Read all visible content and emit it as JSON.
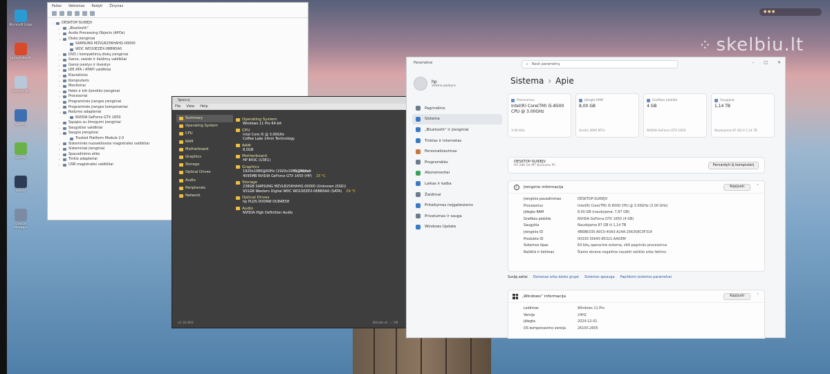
{
  "watermark": "skelbiu.lt",
  "desktop_icons": [
    {
      "label": "Microsoft Edge",
      "icon": "edge-icon",
      "color": "#2b9bd6"
    },
    {
      "label": "Uplay/Ubisoft",
      "icon": "game-launcher-icon",
      "color": "#d84a2a"
    },
    {
      "label": "Recycle Bin",
      "icon": "recycle-bin-icon",
      "color": "#b8c7d9"
    },
    {
      "label": "Speccy",
      "icon": "speccy-icon",
      "color": "#3e6fb0"
    },
    {
      "label": "Spotify",
      "icon": "app-icon",
      "color": "#6bb14a"
    },
    {
      "label": "Steam",
      "icon": "steam-icon",
      "color": "#2e3b57"
    },
    {
      "label": "Device Manager",
      "icon": "device-manager-icon",
      "color": "#7a8ba3"
    }
  ],
  "device_manager": {
    "menu": [
      "Failas",
      "Veiksmas",
      "Rodyti",
      "Žinynas"
    ],
    "tree": [
      {
        "text": "DESKTOP-SUI6EJV",
        "toggle": "⌄",
        "indent": 0
      },
      {
        "text": "„Bluetooth“",
        "toggle": "›",
        "indent": 1
      },
      {
        "text": "Audio Processing Objects (APOs)",
        "toggle": "›",
        "indent": 1
      },
      {
        "text": "Disko įrenginiai",
        "toggle": "⌄",
        "indent": 1
      },
      {
        "text": "SAMSUNG MZVLB256HAHQ-00000",
        "toggle": "",
        "indent": 2
      },
      {
        "text": "WDC WD10EZEX-08BN5A0",
        "toggle": "",
        "indent": 2
      },
      {
        "text": "DVD / kompaktinių diskų įrenginiai",
        "toggle": "›",
        "indent": 1
      },
      {
        "text": "Garso, vaizdo ir žaidimų valdikliai",
        "toggle": "›",
        "indent": 1
      },
      {
        "text": "Garso įvestys ir išvestys",
        "toggle": "›",
        "indent": 1
      },
      {
        "text": "IDE ATA / ATAPI valdikliai",
        "toggle": "›",
        "indent": 1
      },
      {
        "text": "Klaviatūros",
        "toggle": "›",
        "indent": 1
      },
      {
        "text": "Kompiuteris",
        "toggle": "›",
        "indent": 1
      },
      {
        "text": "Monitoriai",
        "toggle": "›",
        "indent": 1
      },
      {
        "text": "Pelės ir kiti žymiklio įrenginiai",
        "toggle": "›",
        "indent": 1
      },
      {
        "text": "Procesoriai",
        "toggle": "›",
        "indent": 1
      },
      {
        "text": "Programinės įrangos įrenginiai",
        "toggle": "›",
        "indent": 1
      },
      {
        "text": "Programinės įrangos komponentai",
        "toggle": "›",
        "indent": 1
      },
      {
        "text": "Rodymo adapteriai",
        "toggle": "⌄",
        "indent": 1
      },
      {
        "text": "NVIDIA GeForce GTX 1650",
        "toggle": "",
        "indent": 2
      },
      {
        "text": "Sąsajos su žmogumi įrenginiai",
        "toggle": "›",
        "indent": 1
      },
      {
        "text": "Saugyklos valdikliai",
        "toggle": "›",
        "indent": 1
      },
      {
        "text": "Saugos įrenginiai",
        "toggle": "⌄",
        "indent": 1
      },
      {
        "text": "Trusted Platform Module 2.0",
        "toggle": "",
        "indent": 2
      },
      {
        "text": "Sisteminės nuosekliosios magistralės valdikliai",
        "toggle": "›",
        "indent": 1
      },
      {
        "text": "Sisteminiai įrenginiai",
        "toggle": "›",
        "indent": 1
      },
      {
        "text": "Spausdinimo eilės",
        "toggle": "›",
        "indent": 1
      },
      {
        "text": "Tinklo adapteriai",
        "toggle": "›",
        "indent": 1
      },
      {
        "text": "USB magistralės valdikliai",
        "toggle": "›",
        "indent": 1
      }
    ]
  },
  "speccy": {
    "title": "Speccy",
    "menu": [
      "File",
      "View",
      "Help"
    ],
    "nav": [
      "Summary",
      "Operating System",
      "CPU",
      "RAM",
      "Motherboard",
      "Graphics",
      "Storage",
      "Optical Drives",
      "Audio",
      "Peripherals",
      "Network"
    ],
    "active_nav": "Summary",
    "sections": [
      {
        "head": "Operating System",
        "lines": [
          {
            "t": "Windows 11 Pro 64-bit",
            "temp": ""
          }
        ]
      },
      {
        "head": "CPU",
        "lines": [
          {
            "t": "Intel Core i5 @ 3.00GHz",
            "temp": ""
          },
          {
            "t": "Coffee Lake 14nm Technology",
            "temp": ""
          }
        ]
      },
      {
        "head": "RAM",
        "lines": [
          {
            "t": "8,0GB",
            "temp": ""
          }
        ]
      },
      {
        "head": "Motherboard",
        "lines": [
          {
            "t": "HP 843C (U3E1)",
            "temp": ""
          }
        ]
      },
      {
        "head": "Graphics",
        "lines": [
          {
            "t": "1920x1080@60Hz (1920x1080@60Hz)",
            "temp": ""
          },
          {
            "t": "4095MB NVIDIA GeForce GTX 1650 (HP)",
            "temp": "23 °C"
          }
        ]
      },
      {
        "head": "Storage",
        "lines": [
          {
            "t": "238GB SAMSUNG MZVLB256HAHQ-00000 (Unknown (SSD))",
            "temp": ""
          },
          {
            "t": "931GB Western Digital WDC WD10EZEX-08BN5A0 (SATA)",
            "temp": "29 °C"
          }
        ]
      },
      {
        "head": "Optical Drives",
        "lines": [
          {
            "t": "hp PLDS DVDRW DU8AESH",
            "temp": ""
          }
        ]
      },
      {
        "head": "Audio",
        "lines": [
          {
            "t": "NVIDIA High Definition Audio",
            "temp": ""
          }
        ]
      }
    ],
    "chipset_note": "% Chipset",
    "version": "v1.32.803",
    "status": "Bitrate of ...: 1M"
  },
  "settings": {
    "window_title": "Parametrai",
    "search_placeholder": "Rasti parametrą",
    "user_name": "hp",
    "user_sub": "Vietinė paskyra",
    "nav": [
      {
        "label": "Pagrindinis",
        "icon": "home-icon",
        "color": "#6b7a8c"
      },
      {
        "label": "Sistema",
        "icon": "system-icon",
        "color": "#3a79c8"
      },
      {
        "label": "„Bluetooth“ ir įrenginiai",
        "icon": "bluetooth-icon",
        "color": "#3a79c8"
      },
      {
        "label": "Tinklas ir internetas",
        "icon": "network-icon",
        "color": "#3a79c8"
      },
      {
        "label": "Personalizavimas",
        "icon": "brush-icon",
        "color": "#c9773a"
      },
      {
        "label": "Programėlės",
        "icon": "apps-icon",
        "color": "#6b7a8c"
      },
      {
        "label": "Abonementai",
        "icon": "account-icon",
        "color": "#3aa05a"
      },
      {
        "label": "Laikas ir kalba",
        "icon": "globe-icon",
        "color": "#3a79c8"
      },
      {
        "label": "Žaidimai",
        "icon": "gamepad-icon",
        "color": "#6b7a8c"
      },
      {
        "label": "Pritaikymas neįgaliesiems",
        "icon": "accessibility-icon",
        "color": "#3a79c8"
      },
      {
        "label": "Privatumas ir sauga",
        "icon": "shield-icon",
        "color": "#6b7a8c"
      },
      {
        "label": "Windows Update",
        "icon": "update-icon",
        "color": "#3a79c8"
      }
    ],
    "active_nav": "Sistema",
    "crumb_parent": "Sistema",
    "crumb_sep": "›",
    "crumb_current": "Apie",
    "cards": [
      {
        "label": "Procesorius",
        "value": "Intel(R) Core(TM) i5-8500 CPU @ 3.00GHz",
        "sub": "3.00 GHz"
      },
      {
        "label": "Įdiegta RAM",
        "value": "8,00 GB",
        "sub": "Greitis 2666 MT/s"
      },
      {
        "label": "Grafikos plokštė",
        "value": "4 GB",
        "sub": "NVIDIA GeForce GTX 1650"
      },
      {
        "label": "Saugykla",
        "value": "1,14 TB",
        "sub": "Naudojama 87 GB iš 1,14 TB"
      }
    ],
    "pc_name": "DESKTOP-SUI6EJV",
    "pc_model": "HP 280 G4 MT Business PC",
    "rename_button": "Pervardyti šį kompiuterį",
    "device_spec_title": "Įrenginio informacija",
    "copy_button": "Kopijuoti",
    "device_spec": [
      {
        "k": "Įrenginio pavadinimas",
        "v": "DESKTOP-SUI6EJV"
      },
      {
        "k": "Procesorius",
        "v": "Intel(R) Core(TM) i5-8500 CPU @ 3.00GHz (3.00 GHz)"
      },
      {
        "k": "Įdiegta RAM",
        "v": "8,00 GB (naudojama: 7,87 GB)"
      },
      {
        "k": "Grafikos plokštė",
        "v": "NVIDIA GeForce GTX 1650 (4 GB)"
      },
      {
        "k": "Saugykla",
        "v": "Naudojama 87 GB iš 1,14 TB"
      },
      {
        "k": "Įrenginio ID",
        "v": "4B6B6335-A0C0-40A3-A24A-256358C0F314"
      },
      {
        "k": "Produkto ID",
        "v": "00330-35645-85321-AAOEM"
      },
      {
        "k": "Sistemos tipas",
        "v": "64 bitų operacinė sistema, x64 pagrindu procesorius"
      },
      {
        "k": "Rašiklis ir lietimas",
        "v": "Šiame ekrane negalima naudoti rašiklio arba lietimo"
      }
    ],
    "links_title": "Susiję saitai",
    "links": [
      "Domenas arba darbo grupė",
      "Sistemos apsauga",
      "Papildomi sistemos parametrai"
    ],
    "win_spec_title": "„Windows“ informacija",
    "win_spec": [
      {
        "k": "Leidimas",
        "v": "Windows 11 Pro"
      },
      {
        "k": "Versija",
        "v": "24H2"
      },
      {
        "k": "Įdiegta",
        "v": "2024-12-01"
      },
      {
        "k": "OS komponavimo versija",
        "v": "26100.2605"
      }
    ]
  }
}
